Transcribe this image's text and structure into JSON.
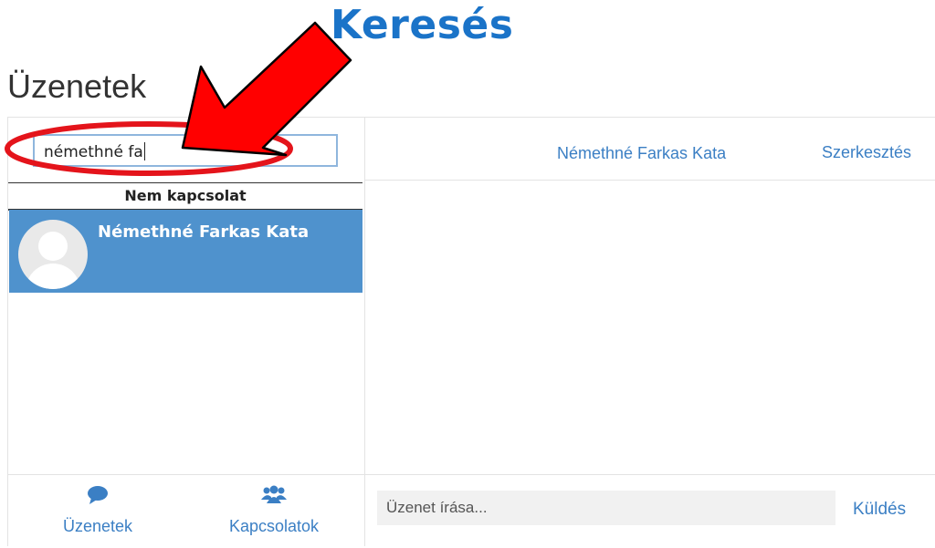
{
  "annotation": {
    "title": "Keresés",
    "arrow_color": "#ff0000",
    "ellipse_color": "#e4141b"
  },
  "page": {
    "title": "Üzenetek"
  },
  "sidebar": {
    "search_value": "némethné fa",
    "section_header": "Nem kapcsolat",
    "contacts": [
      {
        "name": "Némethné Farkas Kata",
        "avatar_icon": "default-user-avatar-icon",
        "selected": true
      }
    ],
    "footer": {
      "messages_label": "Üzenetek",
      "messages_icon": "speech-bubble-icon",
      "contacts_label": "Kapcsolatok",
      "contacts_icon": "users-group-icon"
    }
  },
  "conversation": {
    "name": "Némethné Farkas Kata",
    "edit_label": "Szerkesztés",
    "message_placeholder": "Üzenet írása...",
    "send_label": "Küldés"
  },
  "colors": {
    "accent": "#3b7fc4",
    "selected_row": "#4f92cd",
    "annotation_text": "#1a73c8"
  }
}
